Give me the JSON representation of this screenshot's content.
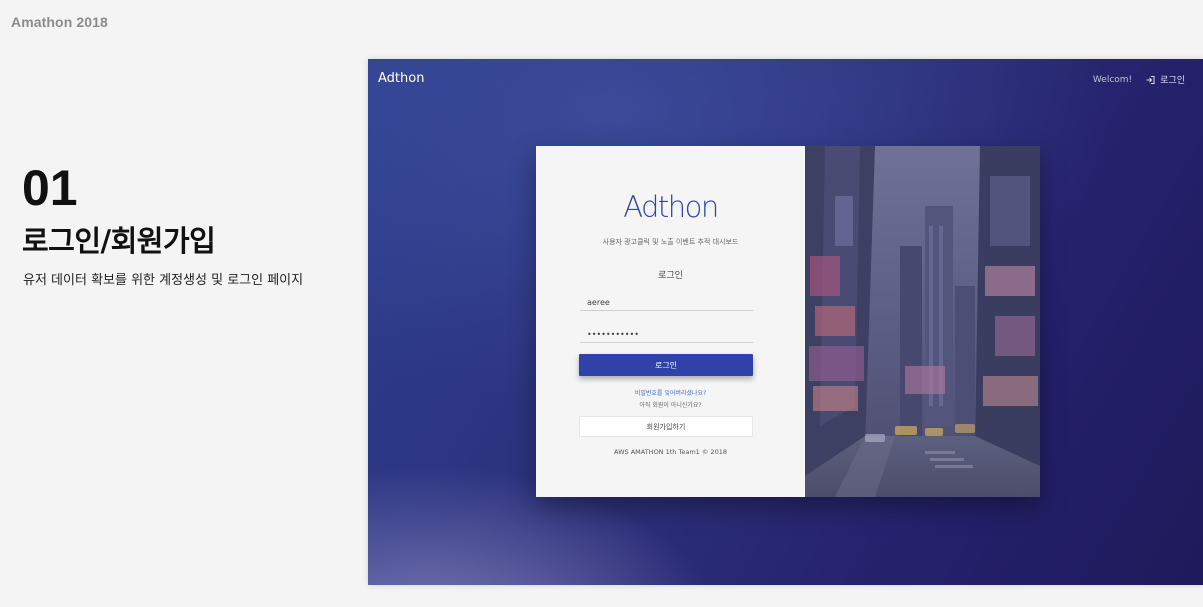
{
  "slide": {
    "title": "Amathon 2018",
    "section_number": "01",
    "section_heading": "로그인/회원가입",
    "section_description": "유저 데이터 확보를 위한 계정생성 및 로그인 페이지"
  },
  "app": {
    "navbar": {
      "brand": "Adthon",
      "welcome": "Welcom!",
      "login_link": "로그인",
      "login_icon": "sign-in-icon"
    },
    "login_card": {
      "logo": "Adthon",
      "subtitle": "사용자 광고클릭 및 노출 이벤트 추적 대시보드",
      "heading": "로그인",
      "username_value": "aeree",
      "password_value": "•••••••••••",
      "login_button": "로그인",
      "forgot_password": "비밀번호를 잊어버리셨나요?",
      "no_account": "아직 회원이 아니신가요?",
      "signup_button": "회원가입하기",
      "footer": "AWS AMATHON 1th Team1 © 2018"
    },
    "colors": {
      "primary": "#2f42a8",
      "logo": "#3345a3",
      "link": "#3f6fc6",
      "background_start": "#2d3f8e",
      "background_end": "#1f1a5a"
    },
    "side_image": "city-street-photo"
  }
}
